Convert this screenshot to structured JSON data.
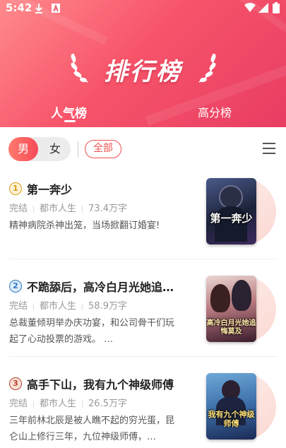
{
  "status": {
    "time": "5:42"
  },
  "header": {
    "banner_title": "排行榜"
  },
  "tabs": [
    {
      "label": "人气榜",
      "active": true
    },
    {
      "label": "高分榜",
      "active": false
    }
  ],
  "filter": {
    "gender_male": "男",
    "gender_female": "女",
    "selected_gender": "男",
    "category": "全部"
  },
  "books": [
    {
      "rank": "1",
      "title": "第一奔少",
      "status": "完结",
      "genre": "都市人生",
      "words": "73.4万字",
      "desc": "精神病院杀神出笼，当场掀翻订婚宴!",
      "cover_text": "第一奔少",
      "rank_color": "#e8a020"
    },
    {
      "rank": "2",
      "title": "不跪舔后，高冷白月光她追…",
      "status": "完结",
      "genre": "都市人生",
      "words": "58.9万字",
      "desc": "总裁董倾玥举办庆功宴，和公司骨干们玩起了心动投票的游戏。 …",
      "cover_text": "高冷白月光她追悔莫及",
      "rank_color": "#3a7fc8"
    },
    {
      "rank": "3",
      "title": "高手下山，我有九个神级师傅",
      "status": "完结",
      "genre": "都市人生",
      "words": "26.5万字",
      "desc": "三年前林北辰是被人瞧不起的穷光蛋，昆仑山上修行三年，九位神级师傅，…",
      "cover_text": "我有九个神级师傅",
      "rank_color": "#c04a3a"
    }
  ]
}
